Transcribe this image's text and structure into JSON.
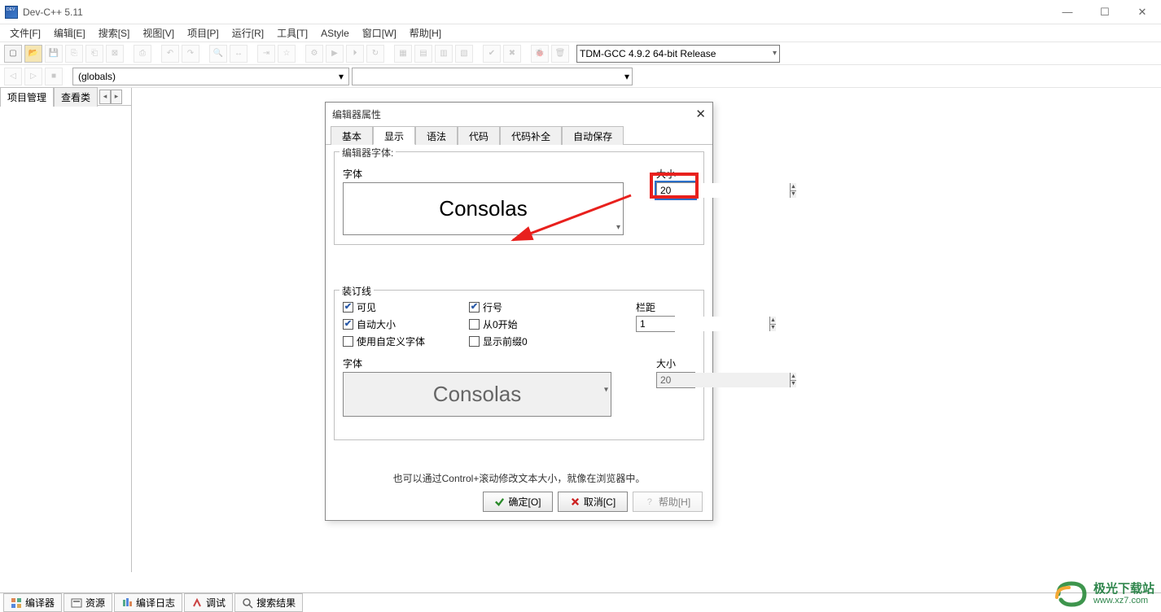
{
  "window": {
    "title": "Dev-C++ 5.11",
    "minimize": "—",
    "maximize": "☐",
    "close": "✕"
  },
  "menu": {
    "file": "文件[F]",
    "edit": "编辑[E]",
    "search": "搜索[S]",
    "view": "视图[V]",
    "project": "项目[P]",
    "run": "运行[R]",
    "tools": "工具[T]",
    "astyle": "AStyle",
    "window": "窗口[W]",
    "help": "帮助[H]"
  },
  "toolbar": {
    "compiler_combo": "TDM-GCC 4.9.2 64-bit Release",
    "globals_combo": "(globals)"
  },
  "side_tabs": {
    "project_mgr": "项目管理",
    "view_class": "查看类"
  },
  "bottom_tabs": {
    "compiler": "编译器",
    "resources": "资源",
    "compile_log": "编译日志",
    "debug": "调试",
    "search_results": "搜索结果"
  },
  "dialog": {
    "title": "编辑器属性",
    "close": "✕",
    "tabs": {
      "basic": "基本",
      "display": "显示",
      "syntax": "语法",
      "code": "代码",
      "code_completion": "代码补全",
      "auto_save": "自动保存"
    },
    "editor_font_group": "编辑器字体:",
    "font_label": "字体",
    "size_label": "大小",
    "font_value": "Consolas",
    "size_value": "20",
    "gutter_group": "装订线",
    "checks": {
      "visible": "可见",
      "auto_size": "自动大小",
      "custom_font": "使用自定义字体",
      "line_number": "行号",
      "from_zero": "从0开始",
      "leading_zero": "显示前缀0"
    },
    "gutter_margin_label": "栏距",
    "gutter_margin_value": "1",
    "gutter_font_label": "字体",
    "gutter_size_label": "大小",
    "gutter_font_value": "Consolas",
    "gutter_size_value": "20",
    "hint": "也可以通过Control+滚动修改文本大小，就像在浏览器中。",
    "ok_btn": "确定[O]",
    "cancel_btn": "取消[C]",
    "help_btn": "帮助[H]"
  },
  "watermark": {
    "name": "极光下载站",
    "url": "www.xz7.com"
  }
}
